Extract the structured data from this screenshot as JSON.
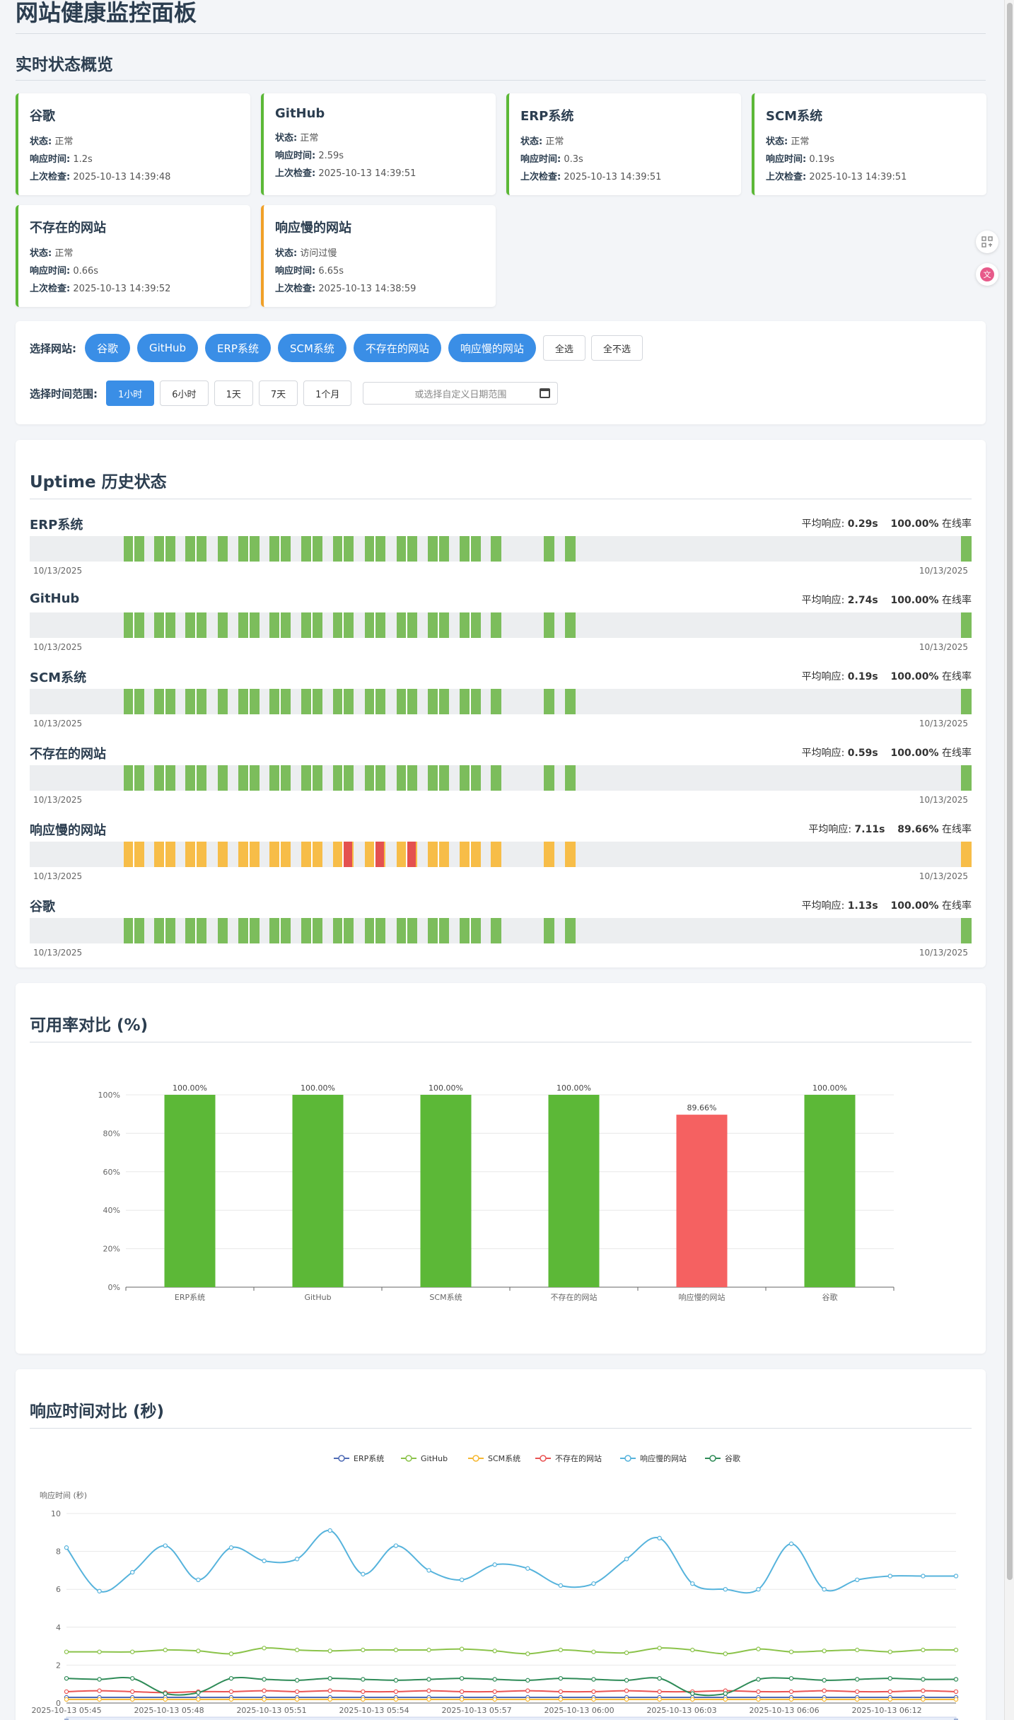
{
  "page_title": "网站健康监控面板",
  "overview_title": "实时状态概览",
  "labels": {
    "status": "状态:",
    "response": "响应时间:",
    "last_check": "上次检查:"
  },
  "cards": [
    {
      "name": "谷歌",
      "status": "正常",
      "response": "1.2s",
      "last_check": "2025-10-13 14:39:48",
      "level": "ok"
    },
    {
      "name": "GitHub",
      "status": "正常",
      "response": "2.59s",
      "last_check": "2025-10-13 14:39:51",
      "level": "ok"
    },
    {
      "name": "ERP系统",
      "status": "正常",
      "response": "0.3s",
      "last_check": "2025-10-13 14:39:51",
      "level": "ok"
    },
    {
      "name": "SCM系统",
      "status": "正常",
      "response": "0.19s",
      "last_check": "2025-10-13 14:39:51",
      "level": "ok"
    },
    {
      "name": "不存在的网站",
      "status": "正常",
      "response": "0.66s",
      "last_check": "2025-10-13 14:39:52",
      "level": "ok"
    },
    {
      "name": "响应慢的网站",
      "status": "访问过慢",
      "response": "6.65s",
      "last_check": "2025-10-13 14:38:59",
      "level": "warn"
    }
  ],
  "filter": {
    "site_label": "选择网站:",
    "sites": [
      "谷歌",
      "GitHub",
      "ERP系统",
      "SCM系统",
      "不存在的网站",
      "响应慢的网站"
    ],
    "select_all": "全选",
    "select_none": "全不选",
    "range_label": "选择时间范围:",
    "ranges": [
      "1小时",
      "6小时",
      "1天",
      "7天",
      "1个月"
    ],
    "active_range": "1小时",
    "date_placeholder": "或选择自定义日期范围"
  },
  "uptime": {
    "title": "Uptime 历史状态",
    "avg_label": "平均响应:",
    "online_label": "在线率",
    "rows": [
      {
        "name": "ERP系统",
        "avg": "0.29s",
        "rate": "100.00%",
        "start": "10/13/2025",
        "end": "10/13/2025",
        "pattern": "ok"
      },
      {
        "name": "GitHub",
        "avg": "2.74s",
        "rate": "100.00%",
        "start": "10/13/2025",
        "end": "10/13/2025",
        "pattern": "ok"
      },
      {
        "name": "SCM系统",
        "avg": "0.19s",
        "rate": "100.00%",
        "start": "10/13/2025",
        "end": "10/13/2025",
        "pattern": "ok"
      },
      {
        "name": "不存在的网站",
        "avg": "0.59s",
        "rate": "100.00%",
        "start": "10/13/2025",
        "end": "10/13/2025",
        "pattern": "ok"
      },
      {
        "name": "响应慢的网站",
        "avg": "7.11s",
        "rate": "89.66%",
        "start": "10/13/2025",
        "end": "10/13/2025",
        "pattern": "slow"
      },
      {
        "name": "谷歌",
        "avg": "1.13s",
        "rate": "100.00%",
        "start": "10/13/2025",
        "end": "10/13/2025",
        "pattern": "ok"
      }
    ]
  },
  "colors": {
    "ok": "#7cbd5c",
    "warn": "#f7bd48",
    "fail": "#e4514f",
    "bar_ok": "#5cb837",
    "bar_bad": "#f56161",
    "chip": "#3a8ee6"
  },
  "availability": {
    "title": "可用率对比 (%)"
  },
  "response": {
    "title": "响应时间对比 (秒)",
    "y_axis_name": "响应时间 (秒)"
  },
  "chart_data": [
    {
      "type": "bar",
      "title": "可用率对比 (%)",
      "categories": [
        "ERP系统",
        "GitHub",
        "SCM系统",
        "不存在的网站",
        "响应慢的网站",
        "谷歌"
      ],
      "values": [
        100.0,
        100.0,
        100.0,
        100.0,
        89.66,
        100.0
      ],
      "data_labels": [
        "100.00%",
        "100.00%",
        "100.00%",
        "100.00%",
        "89.66%",
        "100.00%"
      ],
      "yticks": [
        "0%",
        "20%",
        "40%",
        "60%",
        "80%",
        "100%"
      ],
      "ylim": [
        0,
        100
      ],
      "grid": true
    },
    {
      "type": "line",
      "title": "响应时间对比 (秒)",
      "ylabel": "响应时间 (秒)",
      "ylim": [
        0,
        10
      ],
      "yticks": [
        "0",
        "2",
        "4",
        "6",
        "8",
        "10"
      ],
      "xticks": [
        "2025-10-13 05:45",
        "2025-10-13 05:48",
        "2025-10-13 05:51",
        "2025-10-13 05:54",
        "2025-10-13 05:57",
        "2025-10-13 06:00",
        "2025-10-13 06:03",
        "2025-10-13 06:06",
        "2025-10-13 06:12"
      ],
      "legend_position": "top-center",
      "grid": true,
      "series": [
        {
          "name": "ERP系统",
          "color": "#4f6bb5",
          "values": [
            0.3,
            0.3,
            0.3,
            0.3,
            0.3,
            0.3,
            0.3,
            0.3,
            0.3,
            0.3,
            0.3,
            0.3,
            0.3,
            0.3,
            0.3,
            0.3,
            0.3,
            0.3,
            0.3,
            0.3,
            0.3,
            0.3,
            0.3,
            0.3,
            0.3,
            0.3,
            0.3,
            0.3
          ]
        },
        {
          "name": "GitHub",
          "color": "#8bc34a",
          "values": [
            2.7,
            2.7,
            2.7,
            2.8,
            2.75,
            2.6,
            2.9,
            2.8,
            2.75,
            2.8,
            2.8,
            2.8,
            2.85,
            2.75,
            2.6,
            2.8,
            2.7,
            2.65,
            2.9,
            2.8,
            2.6,
            2.85,
            2.7,
            2.75,
            2.8,
            2.7,
            2.8,
            2.8
          ]
        },
        {
          "name": "SCM系统",
          "color": "#f5b731",
          "values": [
            0.19,
            0.19,
            0.19,
            0.19,
            0.19,
            0.19,
            0.19,
            0.19,
            0.19,
            0.19,
            0.19,
            0.19,
            0.19,
            0.19,
            0.19,
            0.19,
            0.19,
            0.19,
            0.19,
            0.19,
            0.19,
            0.19,
            0.19,
            0.19,
            0.19,
            0.19,
            0.19,
            0.19
          ]
        },
        {
          "name": "不存在的网站",
          "color": "#e95353",
          "values": [
            0.6,
            0.65,
            0.6,
            0.55,
            0.6,
            0.6,
            0.65,
            0.6,
            0.65,
            0.6,
            0.6,
            0.65,
            0.6,
            0.6,
            0.65,
            0.6,
            0.6,
            0.65,
            0.6,
            0.6,
            0.65,
            0.6,
            0.6,
            0.65,
            0.6,
            0.6,
            0.65,
            0.6
          ]
        },
        {
          "name": "响应慢的网站",
          "color": "#56b3dc",
          "values": [
            8.2,
            5.9,
            6.9,
            8.3,
            6.5,
            8.2,
            7.5,
            7.6,
            9.1,
            6.8,
            8.3,
            7.0,
            6.5,
            7.3,
            7.1,
            6.2,
            6.3,
            7.6,
            8.7,
            6.3,
            6.0,
            6.0,
            8.4,
            6.0,
            6.5,
            6.7,
            6.7,
            6.7
          ]
        },
        {
          "name": "谷歌",
          "color": "#2e8b57",
          "values": [
            1.3,
            1.25,
            1.3,
            0.5,
            0.55,
            1.3,
            1.25,
            1.2,
            1.3,
            1.25,
            1.2,
            1.25,
            1.3,
            1.25,
            1.2,
            1.3,
            1.25,
            1.2,
            1.3,
            0.5,
            0.5,
            1.25,
            1.3,
            1.2,
            1.25,
            1.3,
            1.25,
            1.25
          ]
        }
      ]
    }
  ]
}
